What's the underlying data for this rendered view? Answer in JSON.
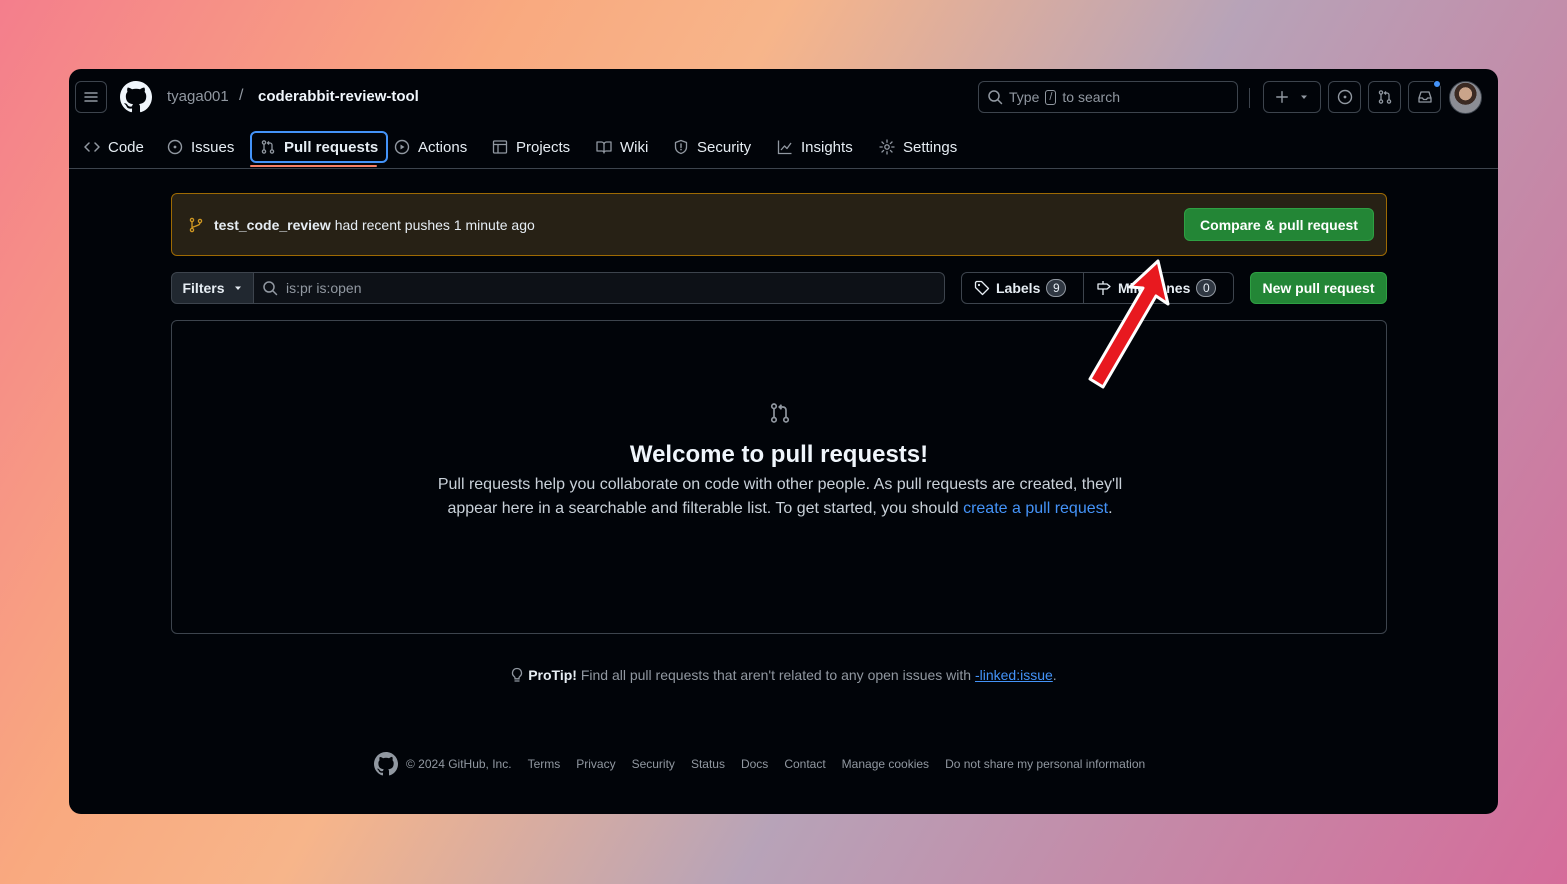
{
  "header": {
    "owner": "tyaga001",
    "separator": "/",
    "repo": "coderabbit-review-tool",
    "search_prefix": "Type",
    "search_key": "/",
    "search_suffix": "to search"
  },
  "tabs": [
    {
      "label": "Code",
      "icon": "code-icon"
    },
    {
      "label": "Issues",
      "icon": "issue-opened-icon"
    },
    {
      "label": "Pull requests",
      "icon": "git-pull-request-icon",
      "active": true
    },
    {
      "label": "Actions",
      "icon": "play-icon"
    },
    {
      "label": "Projects",
      "icon": "table-icon"
    },
    {
      "label": "Wiki",
      "icon": "book-icon"
    },
    {
      "label": "Security",
      "icon": "shield-icon"
    },
    {
      "label": "Insights",
      "icon": "graph-icon"
    },
    {
      "label": "Settings",
      "icon": "gear-icon"
    }
  ],
  "banner": {
    "branch": "test_code_review",
    "message": "had recent pushes 1 minute ago",
    "button": "Compare & pull request"
  },
  "filterbar": {
    "filters_label": "Filters",
    "query": "is:pr is:open",
    "labels_label": "Labels",
    "labels_count": "9",
    "milestones_label": "Milestones",
    "milestones_count": "0",
    "new_pr_button": "New pull request"
  },
  "blankslate": {
    "title": "Welcome to pull requests!",
    "body": "Pull requests help you collaborate on code with other people. As pull requests are created, they'll appear here in a searchable and filterable list. To get started, you should",
    "link": "create a pull request",
    "tail": "."
  },
  "protip": {
    "label": "ProTip!",
    "text": "Find all pull requests that aren't related to any open issues with",
    "link": "-linked:issue",
    "tail": "."
  },
  "footer": {
    "copyright": "© 2024 GitHub, Inc.",
    "links": [
      "Terms",
      "Privacy",
      "Security",
      "Status",
      "Docs",
      "Contact",
      "Manage cookies",
      "Do not share my personal information"
    ]
  },
  "colors": {
    "background": "#010409",
    "accent": "#4493f8",
    "green": "#238636",
    "underline": "#f78166",
    "annotation_arrow": "#e8191f"
  }
}
